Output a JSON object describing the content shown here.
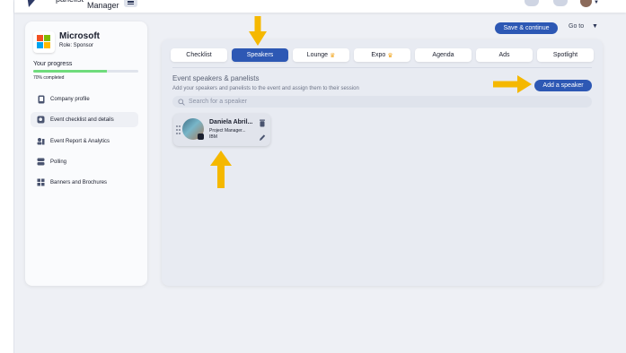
{
  "brand": {
    "top_text": "panelist",
    "name": "Manager"
  },
  "header": {
    "save_label": "Save & continue",
    "goto_label": "Go to"
  },
  "sidebar": {
    "company": "Microsoft",
    "role": "Role: Sponsor",
    "progress_label": "Your progress",
    "progress_value": 0.7,
    "progress_note": "70% completed",
    "items": [
      {
        "label": "Company profile",
        "icon": "phone-icon"
      },
      {
        "label": "Event checklist and details",
        "icon": "checklist-icon"
      },
      {
        "label": "Event Report & Analytics",
        "icon": "analytics-icon"
      },
      {
        "label": "Polling",
        "icon": "polling-icon"
      },
      {
        "label": "Banners and Brochures",
        "icon": "banners-icon"
      }
    ]
  },
  "tabs": [
    {
      "label": "Checklist",
      "crown": false
    },
    {
      "label": "Speakers",
      "crown": false,
      "active": true
    },
    {
      "label": "Lounge",
      "crown": true
    },
    {
      "label": "Expo",
      "crown": true
    },
    {
      "label": "Agenda",
      "crown": false
    },
    {
      "label": "Ads",
      "crown": false
    },
    {
      "label": "Spotlight",
      "crown": false
    }
  ],
  "speakers_section": {
    "title": "Event speakers & panelists",
    "subtitle": "Add your speakers and panelists to the event and assign them to their session",
    "add_label": "Add a speaker",
    "search_placeholder": "Search for a speaker"
  },
  "speaker_card": {
    "name": "Daniela Abril...",
    "title": "Project Manager...",
    "company": "IBM"
  },
  "colors": {
    "primary": "#2d58b4",
    "progress": "#6fdc7c",
    "arrow": "#f5b800",
    "crown": "#f2a825"
  }
}
